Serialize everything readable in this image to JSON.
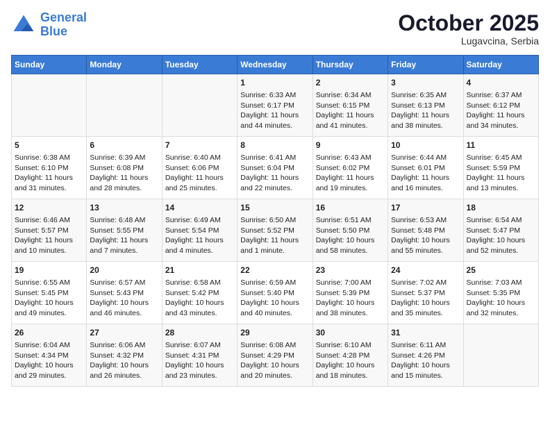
{
  "header": {
    "logo_line1": "General",
    "logo_line2": "Blue",
    "month": "October 2025",
    "location": "Lugavcina, Serbia"
  },
  "days_of_week": [
    "Sunday",
    "Monday",
    "Tuesday",
    "Wednesday",
    "Thursday",
    "Friday",
    "Saturday"
  ],
  "weeks": [
    [
      {
        "day": "",
        "info": ""
      },
      {
        "day": "",
        "info": ""
      },
      {
        "day": "",
        "info": ""
      },
      {
        "day": "1",
        "info": "Sunrise: 6:33 AM\nSunset: 6:17 PM\nDaylight: 11 hours and 44 minutes."
      },
      {
        "day": "2",
        "info": "Sunrise: 6:34 AM\nSunset: 6:15 PM\nDaylight: 11 hours and 41 minutes."
      },
      {
        "day": "3",
        "info": "Sunrise: 6:35 AM\nSunset: 6:13 PM\nDaylight: 11 hours and 38 minutes."
      },
      {
        "day": "4",
        "info": "Sunrise: 6:37 AM\nSunset: 6:12 PM\nDaylight: 11 hours and 34 minutes."
      }
    ],
    [
      {
        "day": "5",
        "info": "Sunrise: 6:38 AM\nSunset: 6:10 PM\nDaylight: 11 hours and 31 minutes."
      },
      {
        "day": "6",
        "info": "Sunrise: 6:39 AM\nSunset: 6:08 PM\nDaylight: 11 hours and 28 minutes."
      },
      {
        "day": "7",
        "info": "Sunrise: 6:40 AM\nSunset: 6:06 PM\nDaylight: 11 hours and 25 minutes."
      },
      {
        "day": "8",
        "info": "Sunrise: 6:41 AM\nSunset: 6:04 PM\nDaylight: 11 hours and 22 minutes."
      },
      {
        "day": "9",
        "info": "Sunrise: 6:43 AM\nSunset: 6:02 PM\nDaylight: 11 hours and 19 minutes."
      },
      {
        "day": "10",
        "info": "Sunrise: 6:44 AM\nSunset: 6:01 PM\nDaylight: 11 hours and 16 minutes."
      },
      {
        "day": "11",
        "info": "Sunrise: 6:45 AM\nSunset: 5:59 PM\nDaylight: 11 hours and 13 minutes."
      }
    ],
    [
      {
        "day": "12",
        "info": "Sunrise: 6:46 AM\nSunset: 5:57 PM\nDaylight: 11 hours and 10 minutes."
      },
      {
        "day": "13",
        "info": "Sunrise: 6:48 AM\nSunset: 5:55 PM\nDaylight: 11 hours and 7 minutes."
      },
      {
        "day": "14",
        "info": "Sunrise: 6:49 AM\nSunset: 5:54 PM\nDaylight: 11 hours and 4 minutes."
      },
      {
        "day": "15",
        "info": "Sunrise: 6:50 AM\nSunset: 5:52 PM\nDaylight: 11 hours and 1 minute."
      },
      {
        "day": "16",
        "info": "Sunrise: 6:51 AM\nSunset: 5:50 PM\nDaylight: 10 hours and 58 minutes."
      },
      {
        "day": "17",
        "info": "Sunrise: 6:53 AM\nSunset: 5:48 PM\nDaylight: 10 hours and 55 minutes."
      },
      {
        "day": "18",
        "info": "Sunrise: 6:54 AM\nSunset: 5:47 PM\nDaylight: 10 hours and 52 minutes."
      }
    ],
    [
      {
        "day": "19",
        "info": "Sunrise: 6:55 AM\nSunset: 5:45 PM\nDaylight: 10 hours and 49 minutes."
      },
      {
        "day": "20",
        "info": "Sunrise: 6:57 AM\nSunset: 5:43 PM\nDaylight: 10 hours and 46 minutes."
      },
      {
        "day": "21",
        "info": "Sunrise: 6:58 AM\nSunset: 5:42 PM\nDaylight: 10 hours and 43 minutes."
      },
      {
        "day": "22",
        "info": "Sunrise: 6:59 AM\nSunset: 5:40 PM\nDaylight: 10 hours and 40 minutes."
      },
      {
        "day": "23",
        "info": "Sunrise: 7:00 AM\nSunset: 5:39 PM\nDaylight: 10 hours and 38 minutes."
      },
      {
        "day": "24",
        "info": "Sunrise: 7:02 AM\nSunset: 5:37 PM\nDaylight: 10 hours and 35 minutes."
      },
      {
        "day": "25",
        "info": "Sunrise: 7:03 AM\nSunset: 5:35 PM\nDaylight: 10 hours and 32 minutes."
      }
    ],
    [
      {
        "day": "26",
        "info": "Sunrise: 6:04 AM\nSunset: 4:34 PM\nDaylight: 10 hours and 29 minutes."
      },
      {
        "day": "27",
        "info": "Sunrise: 6:06 AM\nSunset: 4:32 PM\nDaylight: 10 hours and 26 minutes."
      },
      {
        "day": "28",
        "info": "Sunrise: 6:07 AM\nSunset: 4:31 PM\nDaylight: 10 hours and 23 minutes."
      },
      {
        "day": "29",
        "info": "Sunrise: 6:08 AM\nSunset: 4:29 PM\nDaylight: 10 hours and 20 minutes."
      },
      {
        "day": "30",
        "info": "Sunrise: 6:10 AM\nSunset: 4:28 PM\nDaylight: 10 hours and 18 minutes."
      },
      {
        "day": "31",
        "info": "Sunrise: 6:11 AM\nSunset: 4:26 PM\nDaylight: 10 hours and 15 minutes."
      },
      {
        "day": "",
        "info": ""
      }
    ]
  ]
}
